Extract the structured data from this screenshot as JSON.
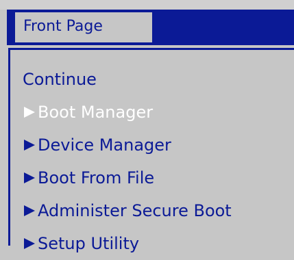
{
  "header": {
    "tab_label": "Front Page"
  },
  "menu": {
    "items": [
      {
        "label": "Continue",
        "has_arrow": false,
        "selected": false
      },
      {
        "label": "Boot Manager",
        "has_arrow": true,
        "selected": true
      },
      {
        "label": "Device Manager",
        "has_arrow": true,
        "selected": false
      },
      {
        "label": "Boot From File",
        "has_arrow": true,
        "selected": false
      },
      {
        "label": "Administer Secure Boot",
        "has_arrow": true,
        "selected": false
      },
      {
        "label": "Setup Utility",
        "has_arrow": true,
        "selected": false
      }
    ]
  },
  "colors": {
    "background": "#c6c6c6",
    "accent_blue": "#0b1a96",
    "selected_text": "#ffffff"
  }
}
